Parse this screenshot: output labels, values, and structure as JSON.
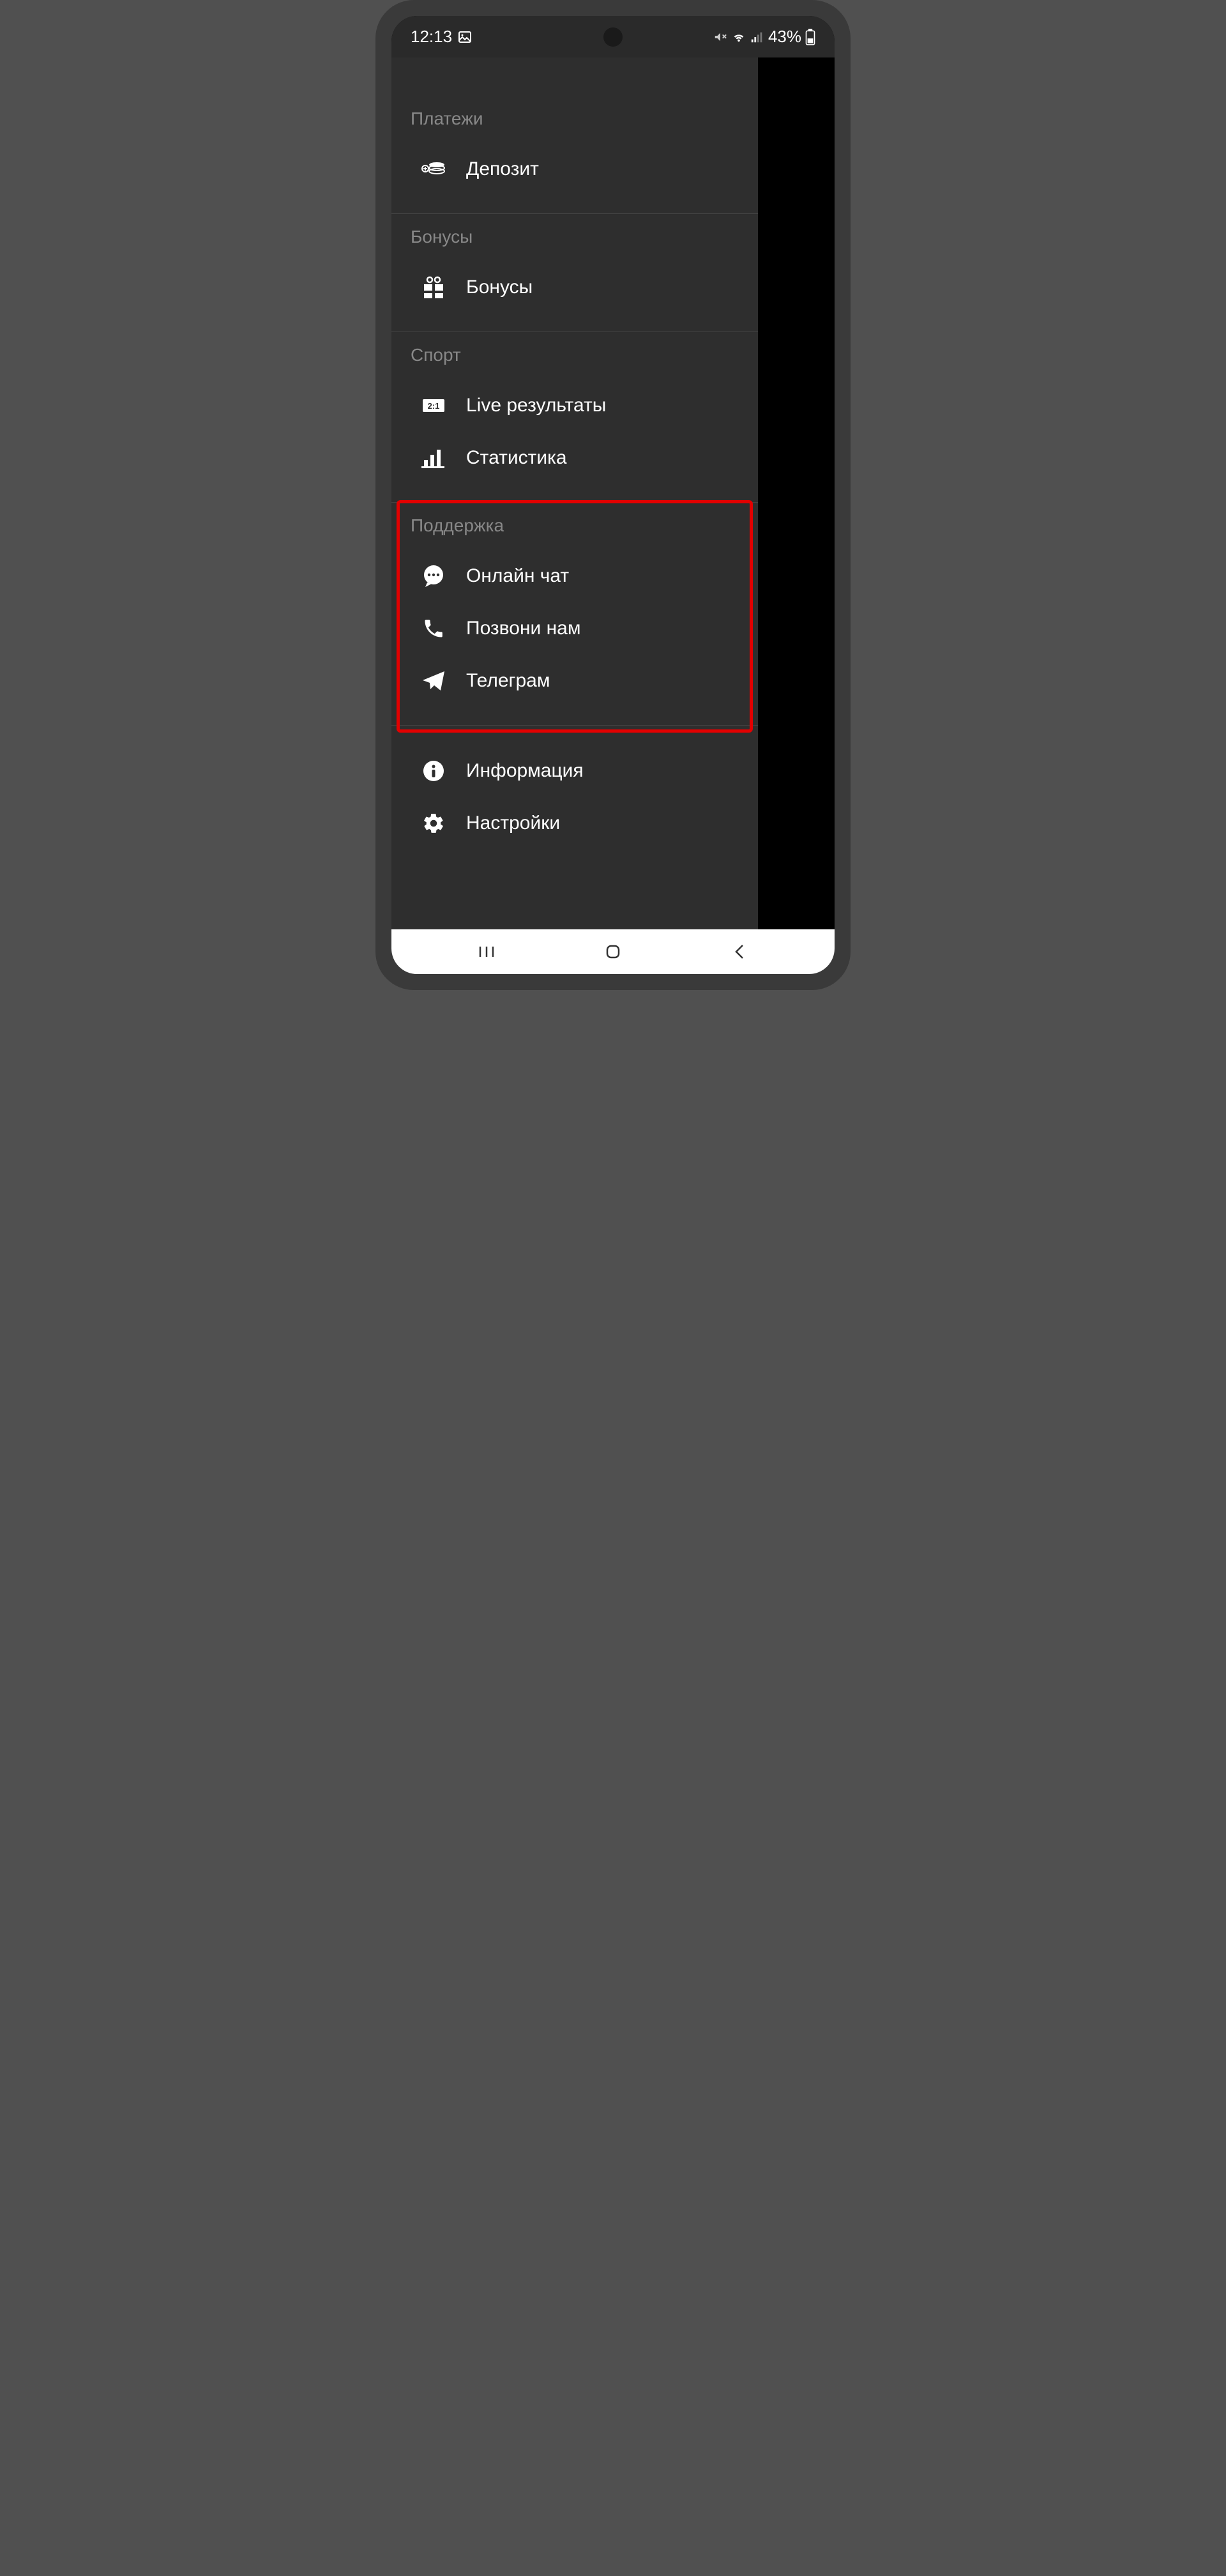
{
  "status": {
    "time": "12:13",
    "battery_pct": "43%"
  },
  "sections": {
    "payments": {
      "title": "Платежи",
      "deposit": "Депозит"
    },
    "bonuses": {
      "title": "Бонусы",
      "bonuses": "Бонусы"
    },
    "sport": {
      "title": "Спорт",
      "live_results": "Live результаты",
      "stats": "Статистика"
    },
    "support": {
      "title": "Поддержка",
      "online_chat": "Онлайн чат",
      "call_us": "Позвони нам",
      "telegram": "Телеграм"
    },
    "other": {
      "info": "Информация",
      "settings": "Настройки"
    }
  }
}
